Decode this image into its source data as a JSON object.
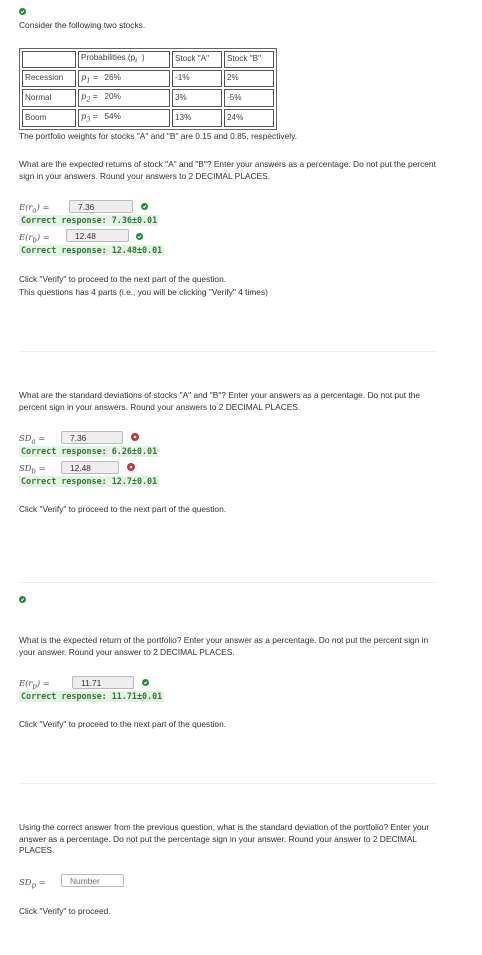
{
  "intro": "Consider the following two stocks.",
  "table": {
    "headers": [
      "",
      "Probabilities (p",
      "Stock \"A\"",
      "Stock \"B\""
    ],
    "header_sub": "i",
    "rows": [
      {
        "state": "Recession",
        "prob_var": "p",
        "prob_sub": "1",
        "prob": "26%",
        "a": "-1%",
        "b": "2%"
      },
      {
        "state": "Normal",
        "prob_var": "p",
        "prob_sub": "2",
        "prob": "20%",
        "a": "3%",
        "b": "-5%"
      },
      {
        "state": "Boom",
        "prob_var": "p",
        "prob_sub": "3",
        "prob": "54%",
        "a": "13%",
        "b": "24%"
      }
    ]
  },
  "weights_text": "The portfolio weights for stocks \"A\" and \"B\" are 0.15 and 0.85, respectively.",
  "part1": {
    "question": "What are the expected returns of stock \"A\" and \"B\"? Enter your answers as a percentage. Do not put the percent sign in your answers. Round your answers to 2 DECIMAL PLACES.",
    "label_a": "E(r",
    "label_a_sub": "a",
    "label_a_end": ") =",
    "value_a": "7.36",
    "resp_a": "Correct response: 7.36±0.01",
    "label_b": "E(r",
    "label_b_sub": "b",
    "label_b_end": ") =",
    "value_b": "12.48",
    "resp_b": "Correct response: 12.48±0.01",
    "verify": "Click \"Verify\" to proceed to the next part of the question.",
    "parts_note": "This questions has 4 parts (i.e., you will be clicking \"Verify\" 4 times)"
  },
  "part2": {
    "question": "What are the standard deviations of stocks \"A\" and \"B\"? Enter your answers as a percentage. Do not put the percent sign in your answers. Round your answers to 2 DECIMAL PLACES.",
    "label_a": "SD",
    "label_a_sub": "a",
    "label_a_end": " =",
    "value_a": "7.36",
    "resp_a": "Correct response: 6.26±0.01",
    "label_b": "SD",
    "label_b_sub": "b",
    "label_b_end": " =",
    "value_b": "12.48",
    "resp_b": "Correct response: 12.7±0.01",
    "verify": "Click \"Verify\" to proceed to the next part of the question."
  },
  "part3": {
    "question": "What is the expected return of the portfolio? Enter your answer as a percentage. Do not put the percent sign in your answer. Round your answer to 2 DECIMAL PLACES.",
    "label": "E(r",
    "label_sub": "p",
    "label_end": ") =",
    "value": "11.71",
    "resp": "Correct response: 11.71±0.01",
    "verify": "Click \"Verify\" to proceed to the next part of the question."
  },
  "part4": {
    "question": "Using the correct answer from the previous question, what is the standard deviation of the portfolio? Enter your answer as a percentage. Do not put the percentage sign in your answer. Round your answer to 2 DECIMAL PLACES.",
    "label": "SD",
    "label_sub": "p",
    "label_end": " =",
    "placeholder": "Number",
    "verify": "Click \"Verify\" to proceed."
  },
  "colors": {
    "correct": "#1f8a38",
    "incorrect": "#c83232",
    "response_bg": "#e5f3e5",
    "response_text": "#2e7d32"
  }
}
